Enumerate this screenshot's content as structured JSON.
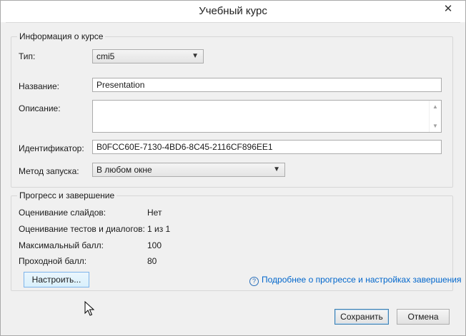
{
  "window": {
    "title": "Учебный курс",
    "close_glyph": "✕"
  },
  "course_info": {
    "group_title": "Информация о курсе",
    "type_label": "Тип:",
    "type_value": "cmi5",
    "name_label": "Название:",
    "name_value": "Presentation",
    "description_label": "Описание:",
    "description_value": "",
    "id_label": "Идентификатор:",
    "id_value": "B0FCC60E-7130-4BD6-8C45-2116CF896EE1",
    "launch_label": "Метод запуска:",
    "launch_value": "В любом окне"
  },
  "progress": {
    "group_title": "Прогресс и завершение",
    "rows": [
      {
        "label": "Оценивание слайдов:",
        "value": "Нет"
      },
      {
        "label": "Оценивание тестов и диалогов:",
        "value": "1 из 1"
      },
      {
        "label": "Максимальный балл:",
        "value": "100"
      },
      {
        "label": "Проходной балл:",
        "value": "80"
      }
    ],
    "configure_button": "Настроить...",
    "help_link": "Подробнее о прогрессе и настройках завершения",
    "help_icon": "?"
  },
  "footer": {
    "save_button": "Сохранить",
    "cancel_button": "Отмена"
  },
  "icons": {
    "dropdown": "▼",
    "scroll_up": "▲",
    "scroll_down": "▼"
  }
}
